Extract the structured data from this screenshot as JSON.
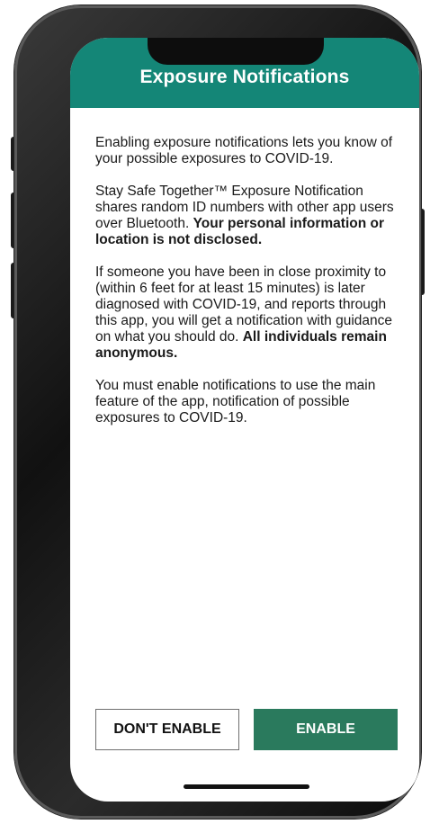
{
  "header": {
    "title": "Exposure Notifications"
  },
  "body": {
    "p1": "Enabling exposure notifications lets you know of your possible exposures to COVID-19.",
    "p2_text": "Stay Safe Together™ Exposure Notification shares random ID numbers with other app users over Bluetooth. ",
    "p2_bold": "Your personal information or location is not disclosed.",
    "p3_text": "If someone you have been in close proximity to (within 6 feet for at least 15 minutes) is later diagnosed with COVID-19, and reports through this app, you will get a notification with guidance on what you should do. ",
    "p3_bold": "All individuals remain anonymous.",
    "p4": "You must enable notifications to use the main feature of the app, notification of possible exposures to COVID-19."
  },
  "actions": {
    "dont_enable_label": "DON'T ENABLE",
    "enable_label": "ENABLE"
  },
  "colors": {
    "header": "#148677",
    "primary_button": "#2a7a5d"
  }
}
